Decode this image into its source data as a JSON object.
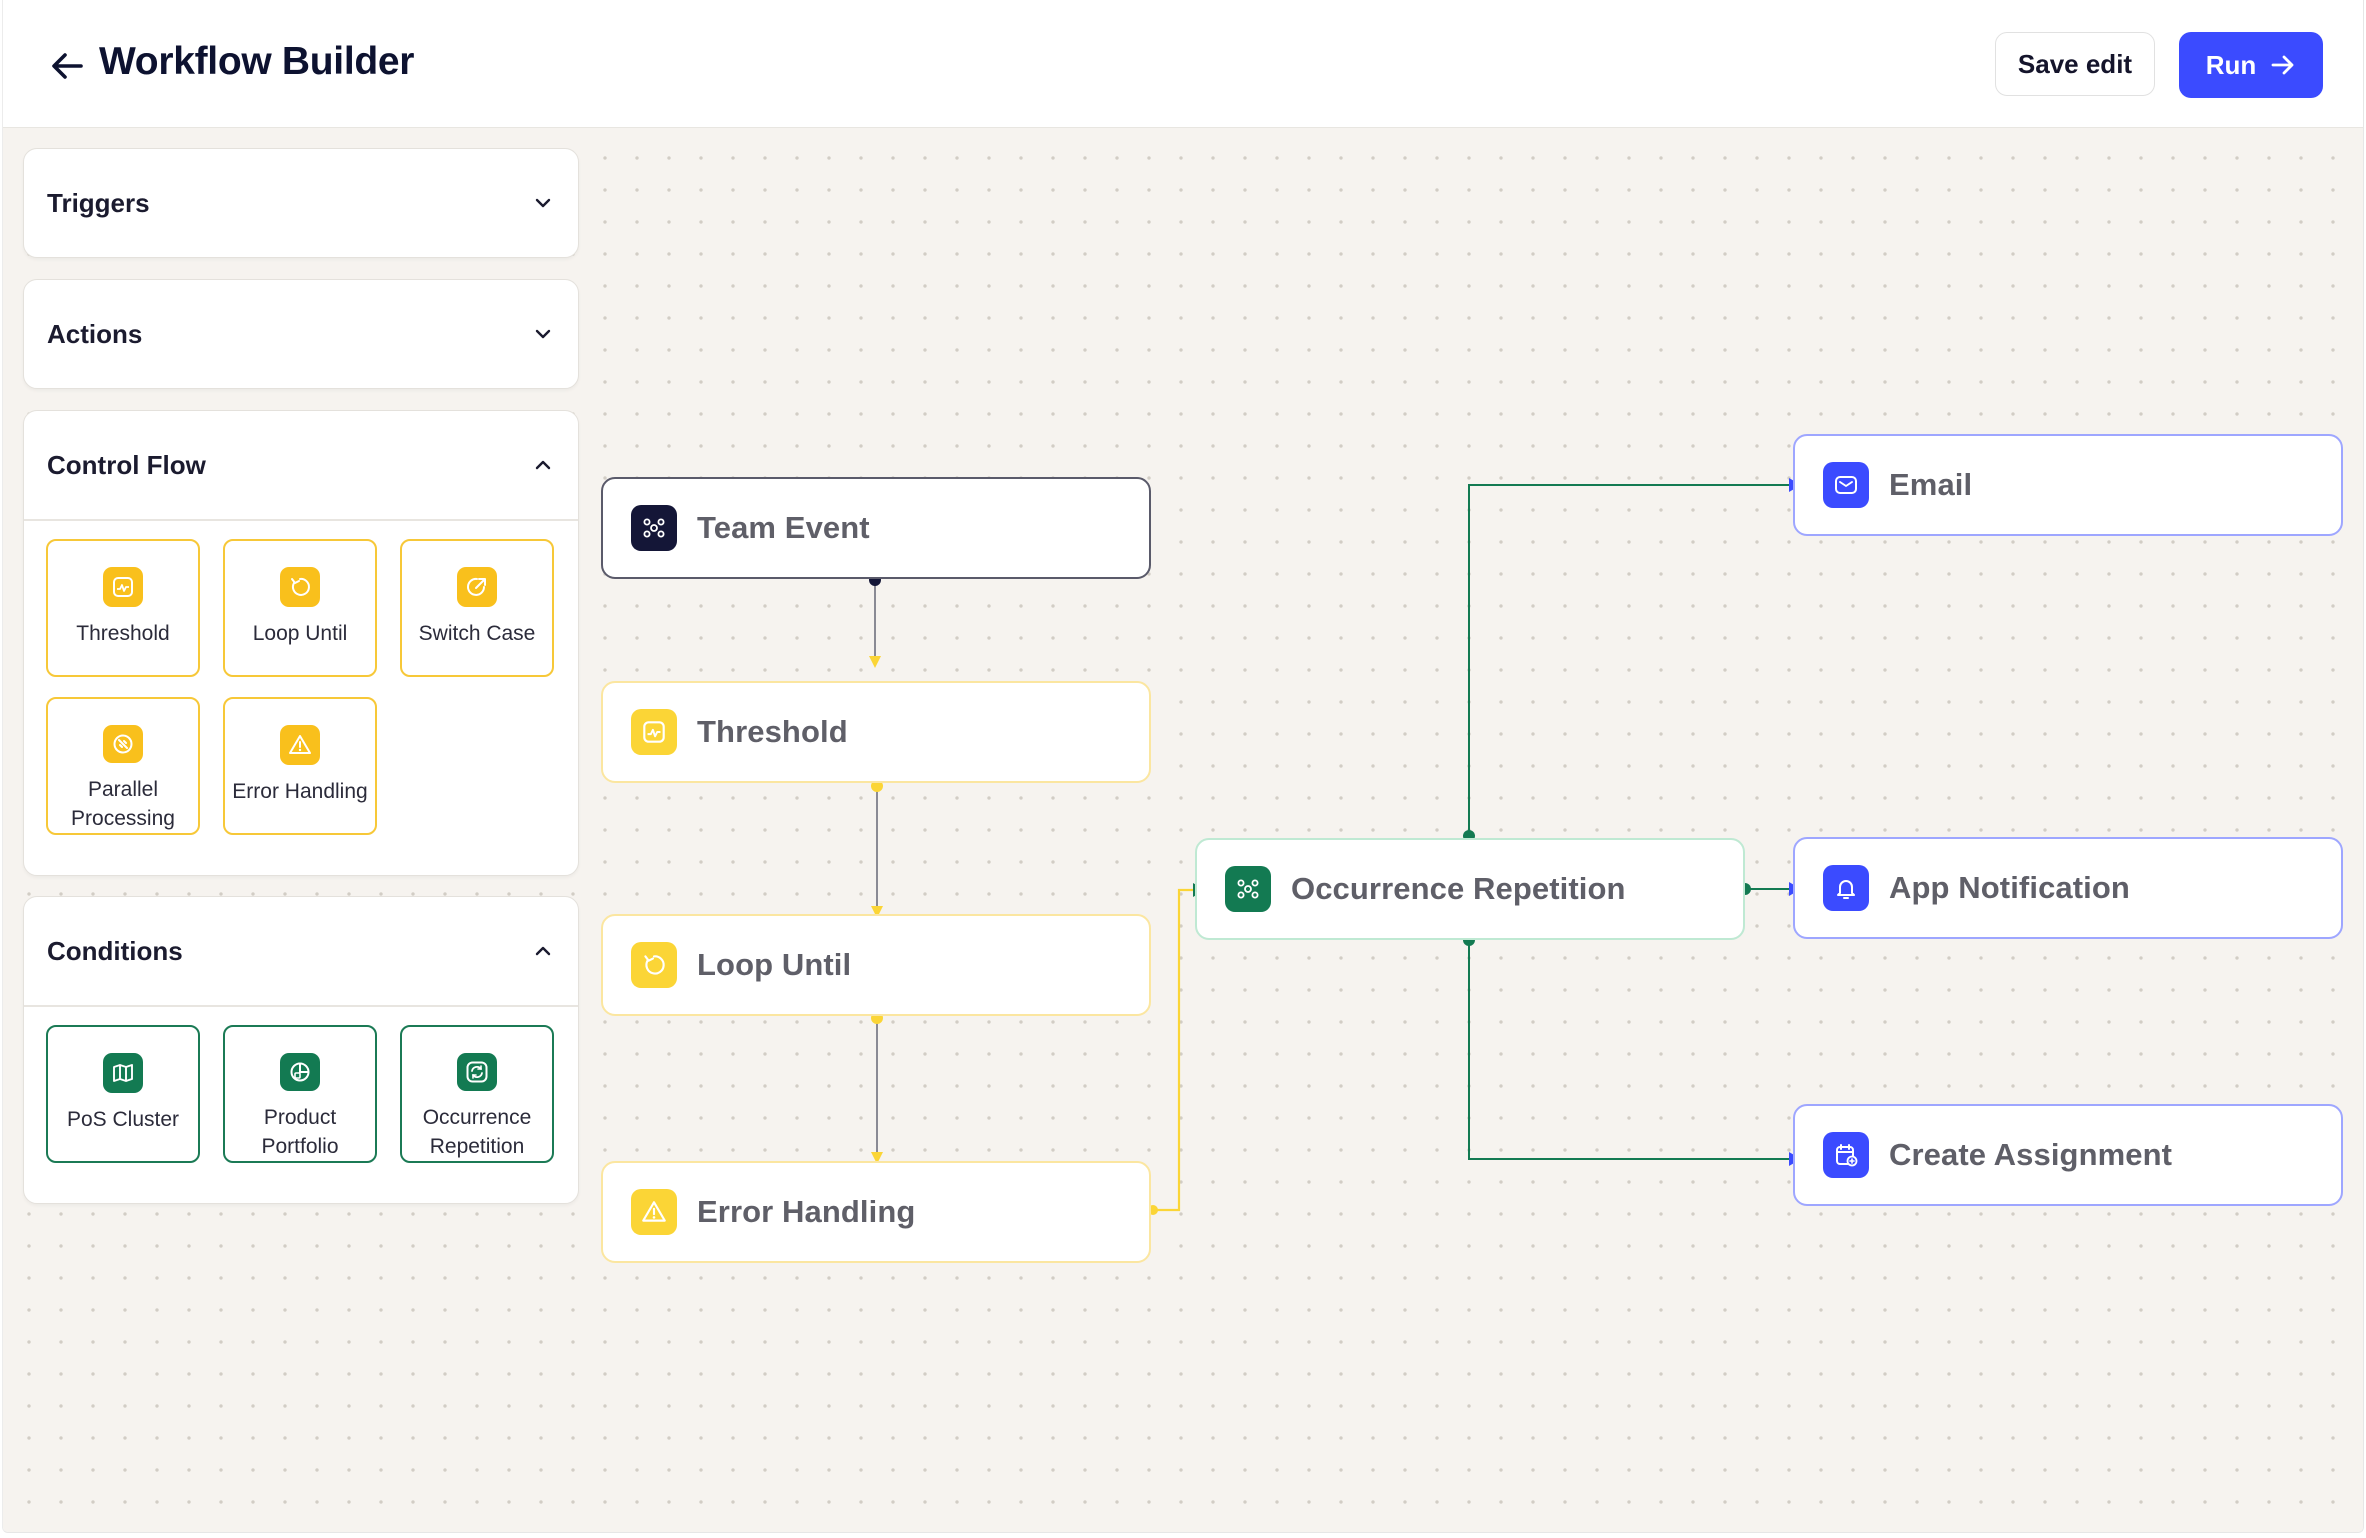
{
  "header": {
    "title": "Workflow Builder",
    "save_label": "Save edit",
    "run_label": "Run",
    "colors": {
      "run_bg": "#3b4bff",
      "title": "#0d1230"
    }
  },
  "sidebar": {
    "triggers": {
      "title": "Triggers",
      "expanded": false,
      "icon": "chevron-down-icon"
    },
    "actions": {
      "title": "Actions",
      "expanded": false,
      "icon": "chevron-down-icon"
    },
    "control_flow": {
      "title": "Control Flow",
      "expanded": true,
      "icon": "chevron-up-icon",
      "accent": "#f9c01c",
      "items": [
        {
          "label": "Threshold",
          "icon": "threshold-icon"
        },
        {
          "label": "Loop Until",
          "icon": "loop-icon"
        },
        {
          "label": "Switch Case",
          "icon": "switch-icon"
        },
        {
          "label": "Parallel Processing",
          "icon": "parallel-icon"
        },
        {
          "label": "Error Handling",
          "icon": "warning-icon"
        }
      ]
    },
    "conditions": {
      "title": "Conditions",
      "expanded": true,
      "icon": "chevron-up-icon",
      "accent": "#137a52",
      "items": [
        {
          "label": "PoS Cluster",
          "icon": "map-icon"
        },
        {
          "label": "Product Portfolio",
          "icon": "portfolio-icon"
        },
        {
          "label": "Occurrence Repetition",
          "icon": "repeat-icon"
        }
      ]
    }
  },
  "canvas": {
    "nodes": {
      "team_event": {
        "label": "Team Event",
        "icon": "team-icon"
      },
      "threshold": {
        "label": "Threshold",
        "icon": "threshold-icon"
      },
      "loop_until": {
        "label": "Loop Until",
        "icon": "loop-icon"
      },
      "error_handling": {
        "label": "Error Handling",
        "icon": "warning-icon"
      },
      "occurrence_repetition": {
        "label": "Occurrence Repetition",
        "icon": "team-icon"
      },
      "email": {
        "label": "Email",
        "icon": "mail-icon"
      },
      "app_notification": {
        "label": "App Notification",
        "icon": "bell-icon"
      },
      "create_assignment": {
        "label": "Create Assignment",
        "icon": "calendar-add-icon"
      }
    },
    "colors": {
      "yellow": "#fbd536",
      "green": "#137a52",
      "blue": "#3b4bff",
      "dark": "#141637"
    }
  }
}
